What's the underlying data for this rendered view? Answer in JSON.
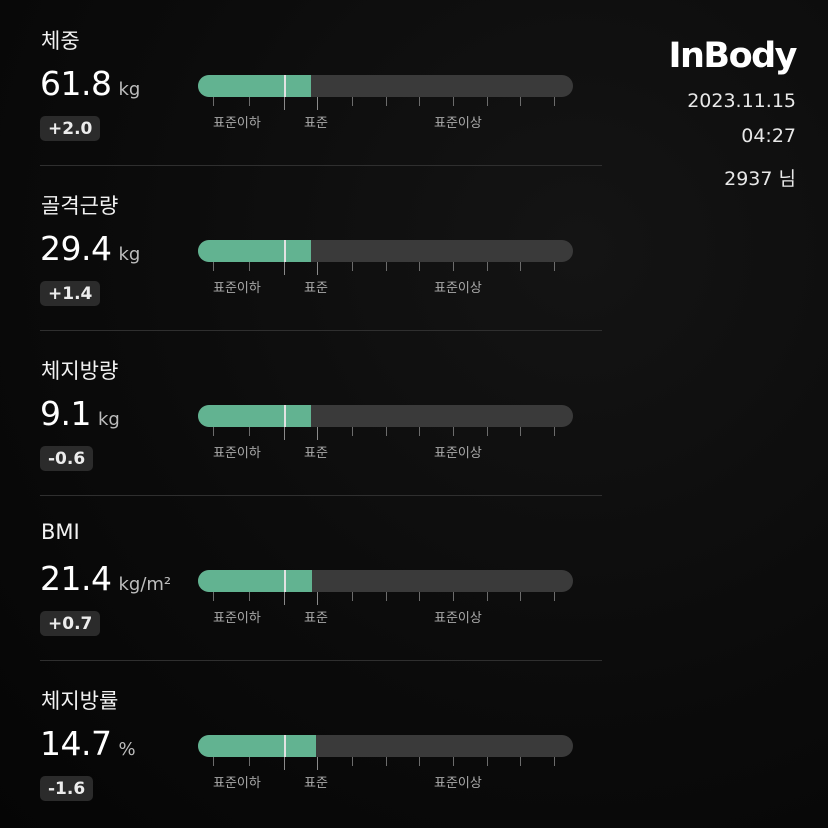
{
  "header": {
    "brand": "InBody",
    "date": "2023.11.15",
    "time": "04:27",
    "user": "2937 님"
  },
  "scale_labels": {
    "below": "표준이하",
    "standard": "표준",
    "above": "표준이상"
  },
  "colors": {
    "fill": "#62b391",
    "track": "#3a3a3a",
    "marker": "#e2e2e2",
    "background": "#0b0b0b"
  },
  "metrics": [
    {
      "name": "체중",
      "value": "61.8",
      "unit": "kg",
      "delta": "+2.0",
      "level": 0.3
    },
    {
      "name": "골격근량",
      "value": "29.4",
      "unit": "kg",
      "delta": "+1.4",
      "level": 0.3
    },
    {
      "name": "체지방량",
      "value": "9.1",
      "unit": "kg",
      "delta": "-0.6",
      "level": 0.3
    },
    {
      "name": "BMI",
      "value": "21.4",
      "unit": "kg/m²",
      "delta": "+0.7",
      "level": 0.305
    },
    {
      "name": "체지방률",
      "value": "14.7",
      "unit": "%",
      "delta": "-1.6",
      "level": 0.315
    }
  ]
}
